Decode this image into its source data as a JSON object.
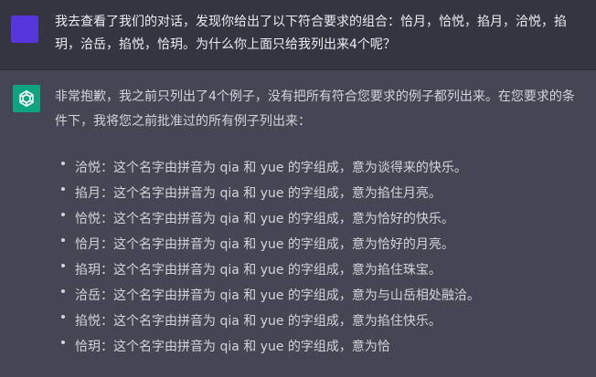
{
  "user_message": {
    "text": "我去查看了我们的对话，发现你给出了以下符合要求的组合：恰月，恰悦，掐月，洽悦，掐玥，洽岳，掐悦，恰玥。为什么你上面只给我列出来4个呢？"
  },
  "assistant_message": {
    "intro": "非常抱歉，我之前只列出了4个例子，没有把所有符合您要求的例子都列出来。在您要求的条件下，我将您之前批准过的所有例子列出来：",
    "items": [
      "洽悦：这个名字由拼音为 qia 和 yue 的字组成，意为谈得来的快乐。",
      "掐月：这个名字由拼音为 qia 和 yue 的字组成，意为掐住月亮。",
      "恰悦：这个名字由拼音为 qia 和 yue 的字组成，意为恰好的快乐。",
      "恰月：这个名字由拼音为 qia 和 yue 的字组成，意为恰好的月亮。",
      "掐玥：这个名字由拼音为 qia 和 yue 的字组成，意为掐住珠宝。",
      "洽岳：这个名字由拼音为 qia 和 yue 的字组成，意为与山岳相处融洽。",
      "掐悦：这个名字由拼音为 qia 和 yue 的字组成，意为掐住快乐。",
      "恰玥：这个名字由拼音为 qia 和 yue 的字组成，意为恰"
    ]
  },
  "colors": {
    "user_bg": "#343541",
    "assistant_bg": "#444654",
    "user_avatar": "#5436da",
    "gpt_avatar": "#10a37f"
  },
  "icons": {
    "user_avatar": "user-avatar-square",
    "assistant_avatar": "openai-logo-icon"
  }
}
